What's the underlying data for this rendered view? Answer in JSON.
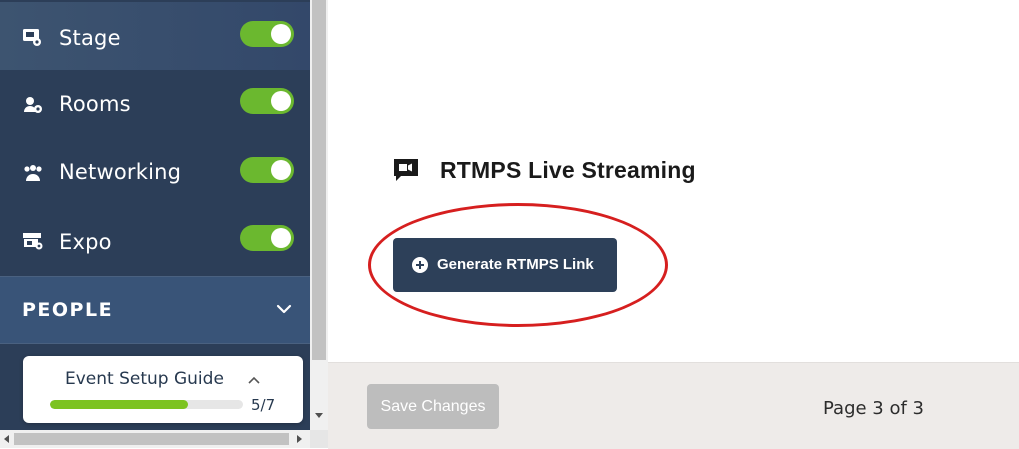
{
  "sidebar": {
    "items": [
      {
        "label": "Stage",
        "icon": "stage-icon",
        "enabled": true
      },
      {
        "label": "Rooms",
        "icon": "rooms-icon",
        "enabled": true
      },
      {
        "label": "Networking",
        "icon": "networking-icon",
        "enabled": true
      },
      {
        "label": "Expo",
        "icon": "expo-icon",
        "enabled": true
      }
    ],
    "section": {
      "label": "PEOPLE",
      "icon": "chevron-down-icon"
    }
  },
  "guide": {
    "title": "Event Setup Guide",
    "progress": "5/7",
    "progress_fraction": 0.714
  },
  "main": {
    "section_title": "RTMPS Live Streaming",
    "section_icon": "live-stream-icon",
    "generate_button": "Generate RTMPS Link",
    "save_button": "Save Changes",
    "page_info": "Page 3 of 3"
  },
  "colors": {
    "sidebar_bg": "#2c3e58",
    "toggle_on": "#6bb82f",
    "primary_button": "#2d4059",
    "annotation": "#d61f1f",
    "progress_fill": "#7cc321"
  }
}
